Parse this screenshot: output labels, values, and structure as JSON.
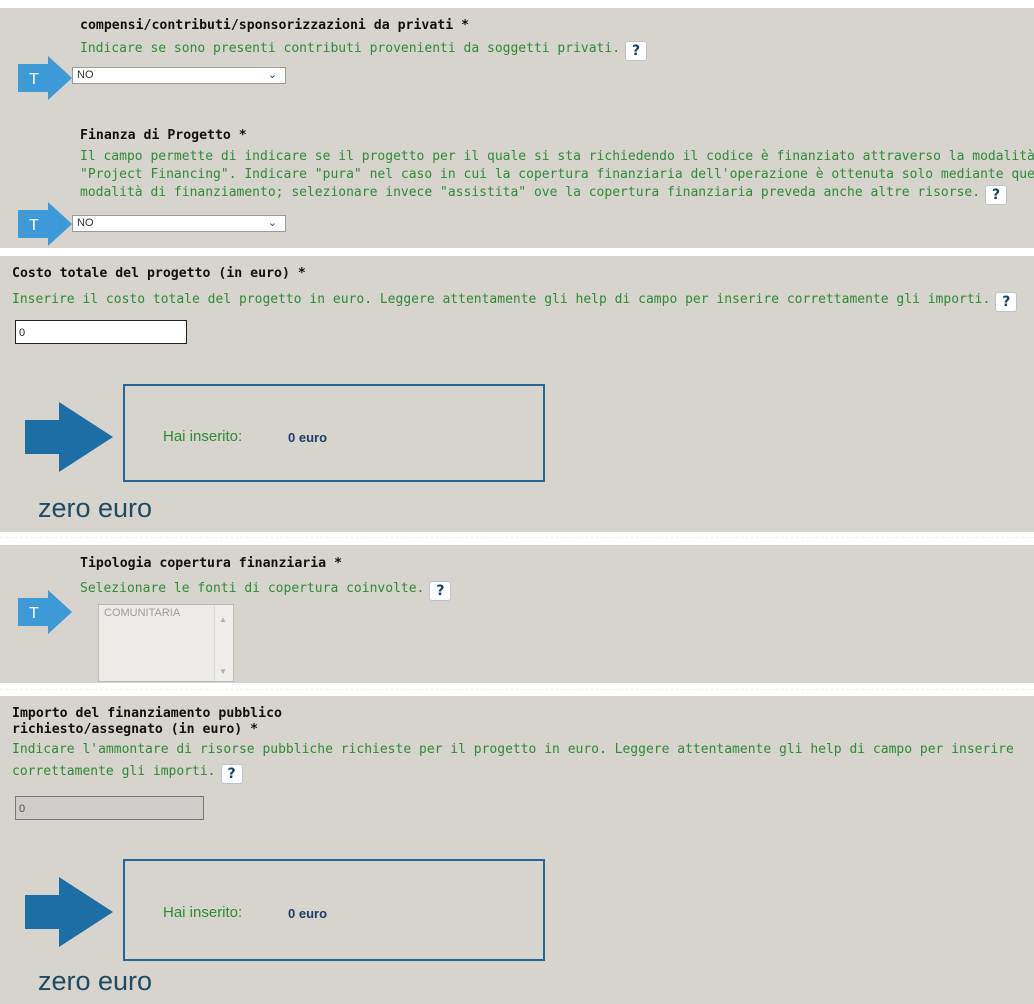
{
  "sections": {
    "compensi": {
      "title": "compensi/contributi/sponsorizzazioni da privati *",
      "help": "Indicare se sono presenti contributi provenienti da soggetti privati.",
      "select_value": "NO",
      "type_icon": "T"
    },
    "finanza": {
      "title": "Finanza di Progetto *",
      "help_line1": "Il campo permette di indicare se il progetto per il quale si sta richiedendo il codice è finanziato attraverso la modalità di",
      "help_line2": "\"Project Financing\". Indicare \"pura\" nel caso in cui la copertura finanziaria dell'operazione è ottenuta solo mediante questa",
      "help_line3": "modalità di finanziamento; selezionare invece \"assistita\" ove la copertura finanziaria preveda anche altre risorse.",
      "select_value": "NO",
      "type_icon": "T"
    },
    "costo": {
      "title": "Costo totale del progetto (in euro) *",
      "help": "Inserire il costo totale del progetto in euro. Leggere attentamente gli help di campo per inserire correttamente gli importi.",
      "input_value": "0",
      "result_label": "Hai inserito:",
      "result_value": "0 euro",
      "in_words": "zero euro"
    },
    "tipologia": {
      "title": "Tipologia copertura finanziaria *",
      "help": "Selezionare le fonti di copertura coinvolte.",
      "options": [
        "COMUNITARIA"
      ],
      "type_icon": "T"
    },
    "importo": {
      "title_line1": "Importo del finanziamento pubblico",
      "title_line2": "richiesto/assegnato (in euro) *",
      "help_line1": "Indicare l'ammontare di risorse pubbliche richieste per il progetto in euro. Leggere attentamente gli help di campo per inserire",
      "help_line2": "correttamente gli importi.",
      "input_value": "0",
      "result_label": "Hai inserito:",
      "result_value": "0 euro",
      "in_words": "zero euro"
    }
  },
  "help_glyph": "?",
  "colors": {
    "panel": "#d7d3cd",
    "help_text": "#2e8b36",
    "arrow": "#1c6ea4",
    "t_arrow": "#3d9ad6",
    "box_border": "#2a6496"
  }
}
